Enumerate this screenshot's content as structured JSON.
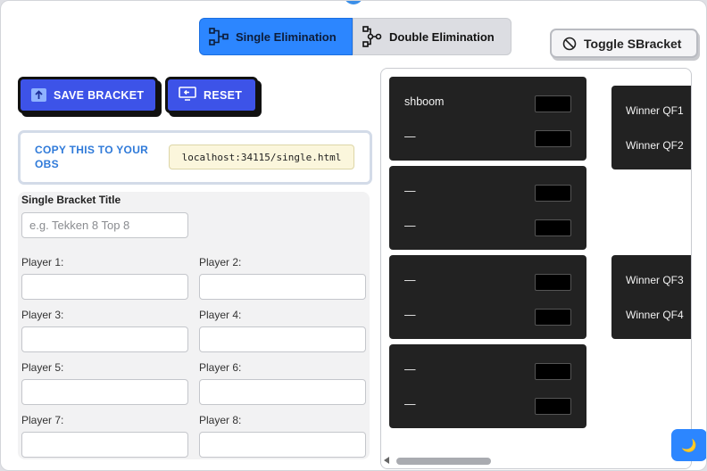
{
  "modes": {
    "single_label": "Single Elimination",
    "double_label": "Double Elimination"
  },
  "toggle_label": "Toggle SBracket",
  "actions": {
    "save_label": "SAVE BRACKET",
    "reset_label": "RESET"
  },
  "copy": {
    "label": "COPY THIS TO YOUR OBS",
    "url": "localhost:34115/single.html"
  },
  "form": {
    "title_label": "Single Bracket Title",
    "title_placeholder": "e.g. Tekken 8 Top 8",
    "players": [
      {
        "label": "Player 1:",
        "value": ""
      },
      {
        "label": "Player 2:",
        "value": ""
      },
      {
        "label": "Player 3:",
        "value": ""
      },
      {
        "label": "Player 4:",
        "value": ""
      },
      {
        "label": "Player 5:",
        "value": ""
      },
      {
        "label": "Player 6:",
        "value": ""
      },
      {
        "label": "Player 7:",
        "value": ""
      },
      {
        "label": "Player 8:",
        "value": ""
      }
    ]
  },
  "bracket": {
    "matches": [
      {
        "p1": "shboom",
        "p2": "—"
      },
      {
        "p1": "—",
        "p2": "—"
      },
      {
        "p1": "—",
        "p2": "—"
      },
      {
        "p1": "—",
        "p2": "—"
      }
    ],
    "quarterfinals": [
      {
        "p1": "Winner QF1",
        "p2": "Winner QF2"
      },
      {
        "p1": "Winner QF3",
        "p2": "Winner QF4"
      }
    ]
  },
  "icons": {
    "single": "bracket-icon",
    "double": "double-bracket-icon",
    "toggle": "no-entry-icon",
    "save": "upload-icon",
    "reset": "reset-icon",
    "theme": "moon-icon"
  },
  "colors": {
    "accent": "#2c86ff",
    "action": "#3d53e8",
    "match_bg": "#222222"
  }
}
